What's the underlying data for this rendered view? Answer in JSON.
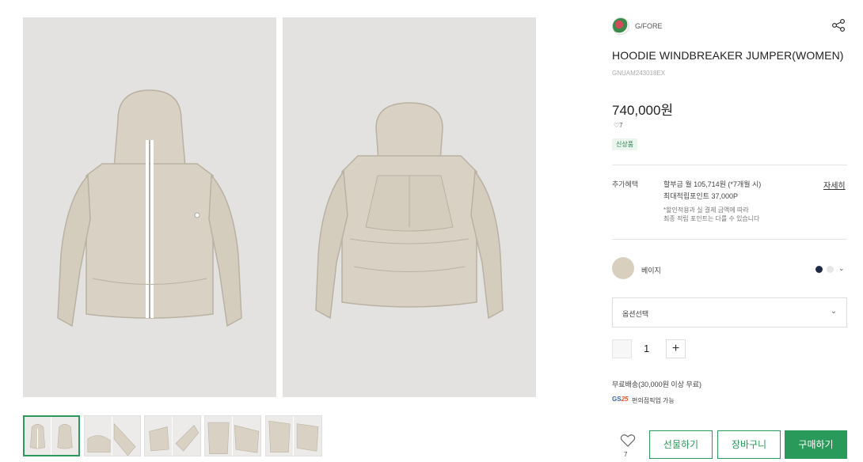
{
  "product": {
    "brand": "G/FORE",
    "title": "HOODIE WINDBREAKER JUMPER(WOMEN)",
    "sku": "GNUAM243018EX",
    "price": "740,000원",
    "likes": "7",
    "badge": "신상품"
  },
  "benefits": {
    "label": "추가혜택",
    "installment": "할부금 월 105,714원 (*7개월 시)",
    "points": "최대적립포인트 37,000P",
    "note_line1": "*할인적용과 실 결제 금액에 따라",
    "note_line2": "최종 적립 포인트는 다를 수 있습니다",
    "detail_link": "자세히"
  },
  "color": {
    "selected_name": "베이지",
    "swatch": "#d8cfbf",
    "options": [
      "#1f2a44",
      "#e6e6e6"
    ]
  },
  "option_select": {
    "label": "옵션선택"
  },
  "quantity": {
    "value": "1",
    "minus_icon": "minus-icon",
    "plus_icon": "plus-icon",
    "plus_glyph": "+"
  },
  "shipping": {
    "free_shipping": "무료배송(30,000원 이상 무료)",
    "cvs_logo_text": "GS",
    "cvs_logo_num": "25",
    "cvs_pickup": "편의점픽업 가능"
  },
  "actions": {
    "wish_count": "7",
    "gift_label": "선물하기",
    "cart_label": "장바구니",
    "buy_label": "구매하기"
  },
  "colors": {
    "accent": "#2a9a5a",
    "image_bg": "#e3e2e0",
    "jacket": "#d9d2c4"
  }
}
